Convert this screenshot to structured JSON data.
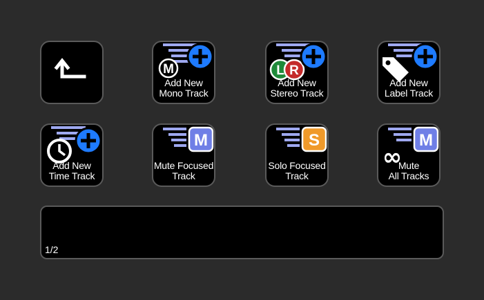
{
  "colors": {
    "background": "#2b2b2b",
    "key_fill": "#000000",
    "key_border": "#5a5a5a",
    "stripes": "#9ea8f0",
    "plus_blue": "#1e7bff",
    "m_badge": "#6f7fe6",
    "s_badge": "#f09a2a",
    "l_green": "#1f8a3a",
    "r_red": "#c42a2a"
  },
  "keys": [
    {
      "icon": "back-arrow-icon",
      "line1": "",
      "line2": ""
    },
    {
      "icon": "add-mono-track-icon",
      "glyph": "M",
      "line1": "Add New",
      "line2": "Mono Track"
    },
    {
      "icon": "add-stereo-track-icon",
      "glyph_l": "L",
      "glyph_r": "R",
      "line1": "Add New",
      "line2": "Stereo Track"
    },
    {
      "icon": "add-label-track-icon",
      "line1": "Add New",
      "line2": "Label Track"
    },
    {
      "icon": "add-time-track-icon",
      "line1": "Add New",
      "line2": "Time Track"
    },
    {
      "icon": "mute-focused-icon",
      "glyph": "M",
      "line1": "Mute Focused",
      "line2": "Track"
    },
    {
      "icon": "solo-focused-icon",
      "glyph": "S",
      "line1": "Solo Focused",
      "line2": "Track"
    },
    {
      "icon": "mute-all-icon",
      "glyph": "M",
      "glyph_inf": "∞",
      "line1": "Mute",
      "line2": "All Tracks"
    }
  ],
  "info_bar": {
    "page": "1/2"
  }
}
